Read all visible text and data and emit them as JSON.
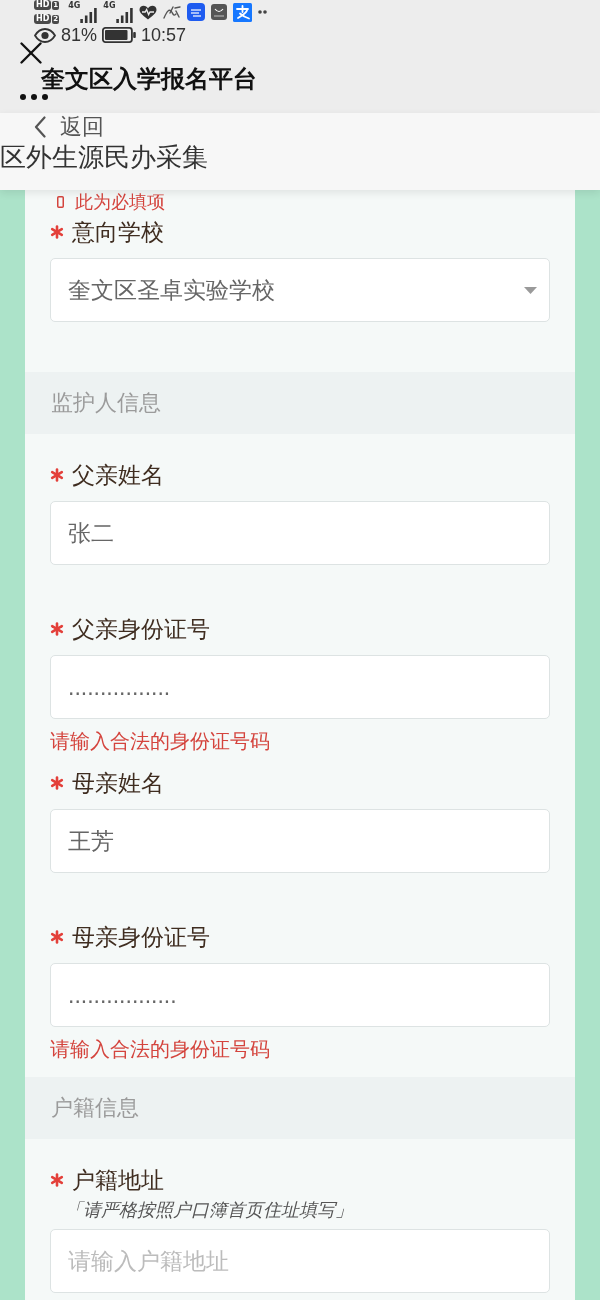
{
  "status_bar": {
    "sim_badges": [
      {
        "label": "HD",
        "slot": "1"
      },
      {
        "label": "HD",
        "slot": "2"
      }
    ],
    "networks": [
      "4G",
      "4G"
    ],
    "battery": "81%",
    "time": "10:57"
  },
  "title_bar": {
    "title": "奎文区入学报名平台"
  },
  "nav_bar": {
    "back": "返回",
    "title": "区外生源民办采集"
  },
  "form": {
    "items": [
      {
        "kind": "error",
        "text": "此为必填项"
      },
      {
        "kind": "select",
        "label": "意向学校",
        "required": true,
        "value": "奎文区圣卓实验学校"
      },
      {
        "kind": "section",
        "title": "监护人信息"
      },
      {
        "kind": "input",
        "label": "父亲姓名",
        "required": true,
        "value": "张二"
      },
      {
        "kind": "input",
        "label": "父亲身份证号",
        "required": true,
        "value": "................",
        "error": "请输入合法的身份证号码"
      },
      {
        "kind": "input",
        "label": "母亲姓名",
        "required": true,
        "value": "王芳"
      },
      {
        "kind": "input",
        "label": "母亲身份证号",
        "required": true,
        "value": ".................",
        "error": "请输入合法的身份证号码"
      },
      {
        "kind": "section",
        "title": "户籍信息"
      },
      {
        "kind": "input",
        "label": "户籍地址",
        "required": true,
        "hint": "「请严格按照户口簿首页住址填写」",
        "placeholder": "请输入户籍地址"
      }
    ]
  }
}
